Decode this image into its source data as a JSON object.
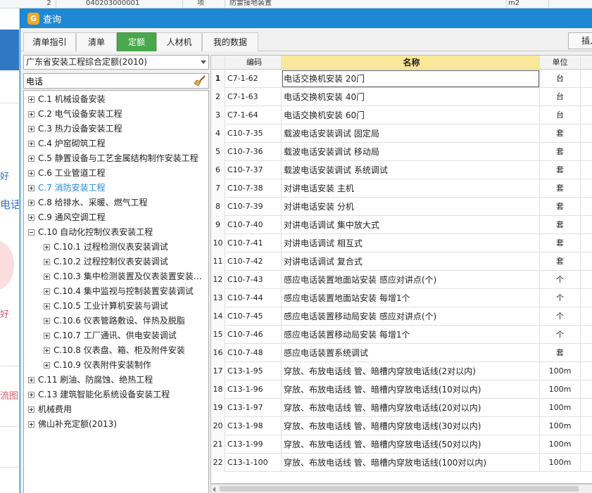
{
  "background": {
    "row_number": "2",
    "code": "040203000001",
    "col3": "项",
    "name": "防雷接地装置",
    "unit": "m2",
    "left_fragments": [
      "好",
      "电话",
      "好",
      "流图"
    ]
  },
  "window": {
    "title": "查询",
    "logo_glyph": "G"
  },
  "tabs": [
    {
      "label": "清单指引"
    },
    {
      "label": "清单"
    },
    {
      "label": "定额",
      "active": true
    },
    {
      "label": "人材机"
    },
    {
      "label": "我的数据"
    }
  ],
  "insert_button": "插入",
  "left": {
    "quota_library": "广东省安装工程综合定额(2010)",
    "search_value": "电话",
    "tree": [
      {
        "label": "C.1 机械设备安装",
        "expanded": false
      },
      {
        "label": "C.2 电气设备安装工程",
        "expanded": false
      },
      {
        "label": "C.3 热力设备安装工程",
        "expanded": false
      },
      {
        "label": "C.4 炉窑砌筑工程",
        "expanded": false
      },
      {
        "label": "C.5 静置设备与工艺金属结构制作安装工程",
        "expanded": false
      },
      {
        "label": "C.6 工业管道工程",
        "expanded": false
      },
      {
        "label": "C.7 消防安装工程",
        "expanded": false,
        "selected": true
      },
      {
        "label": "C.8 给排水、采暖、燃气工程",
        "expanded": false
      },
      {
        "label": "C.9 通风空调工程",
        "expanded": false
      },
      {
        "label": "C.10 自动化控制仪表安装工程",
        "expanded": true
      },
      {
        "label": "C.10.1 过程检测仪表安装调试",
        "level": 1
      },
      {
        "label": "C.10.2 过程控制仪表安装调试",
        "level": 1
      },
      {
        "label": "C.10.3 集中检测装置及仪表装置安装…",
        "level": 1
      },
      {
        "label": "C.10.4 集中监视与控制装置安装调试",
        "level": 1
      },
      {
        "label": "C.10.5 工业计算机安装与调试",
        "level": 1
      },
      {
        "label": "C.10.6 仪表管路敷设、伴热及脱脂",
        "level": 1
      },
      {
        "label": "C.10.7 工厂通讯、供电安装调试",
        "level": 1
      },
      {
        "label": "C.10.8 仪表盘、箱、柜及附件安装",
        "level": 1
      },
      {
        "label": "C.10.9 仪表附件安装制作",
        "level": 1
      },
      {
        "label": "C.11 刷油、防腐蚀、绝热工程",
        "expanded": false
      },
      {
        "label": "C.13 建筑智能化系统设备安装工程",
        "expanded": false
      },
      {
        "label": "机械费用",
        "expanded": false
      },
      {
        "label": "佛山补充定额(2013)",
        "expanded": false
      }
    ]
  },
  "grid": {
    "headers": {
      "code": "编码",
      "name": "名称",
      "unit": "单位"
    },
    "rows": [
      {
        "idx": "1",
        "code": "C7-1-62",
        "name": "电话交换机安装 20门",
        "unit": "台"
      },
      {
        "idx": "2",
        "code": "C7-1-63",
        "name": "电话交换机安装 40门",
        "unit": "台"
      },
      {
        "idx": "3",
        "code": "C7-1-64",
        "name": "电话交换机安装 60门",
        "unit": "台"
      },
      {
        "idx": "4",
        "code": "C10-7-35",
        "name": "载波电话安装调试 固定局",
        "unit": "套"
      },
      {
        "idx": "5",
        "code": "C10-7-36",
        "name": "载波电话安装调试 移动局",
        "unit": "套"
      },
      {
        "idx": "6",
        "code": "C10-7-37",
        "name": "载波电话安装调试 系统调试",
        "unit": "套"
      },
      {
        "idx": "7",
        "code": "C10-7-38",
        "name": "对讲电话安装 主机",
        "unit": "套"
      },
      {
        "idx": "8",
        "code": "C10-7-39",
        "name": "对讲电话安装 分机",
        "unit": "套"
      },
      {
        "idx": "9",
        "code": "C10-7-40",
        "name": "对讲电话调试 集中放大式",
        "unit": "套"
      },
      {
        "idx": "10",
        "code": "C10-7-41",
        "name": "对讲电话调试 相互式",
        "unit": "套"
      },
      {
        "idx": "11",
        "code": "C10-7-42",
        "name": "对讲电话调试 复合式",
        "unit": "套"
      },
      {
        "idx": "12",
        "code": "C10-7-43",
        "name": "感应电话装置地面站安装 感应对讲点(个)",
        "unit": "个"
      },
      {
        "idx": "13",
        "code": "C10-7-44",
        "name": "感应电话装置地面站安装 每增1个",
        "unit": "个"
      },
      {
        "idx": "14",
        "code": "C10-7-45",
        "name": "感应电话装置移动局安装 感应对讲点(个)",
        "unit": "个"
      },
      {
        "idx": "15",
        "code": "C10-7-46",
        "name": "感应电话装置移动局安装 每增1个",
        "unit": "个"
      },
      {
        "idx": "16",
        "code": "C10-7-48",
        "name": "感应电话装置系统调试",
        "unit": "套"
      },
      {
        "idx": "17",
        "code": "C13-1-95",
        "name": "穿放、布放电话线 管、暗槽内穿放电话线(2对以内)",
        "unit": "100m"
      },
      {
        "idx": "18",
        "code": "C13-1-96",
        "name": "穿放、布放电话线 管、暗槽内穿放电话线(10对以内)",
        "unit": "100m"
      },
      {
        "idx": "19",
        "code": "C13-1-97",
        "name": "穿放、布放电话线 管、暗槽内穿放电话线(20对以内)",
        "unit": "100m"
      },
      {
        "idx": "20",
        "code": "C13-1-98",
        "name": "穿放、布放电话线 管、暗槽内穿放电话线(30对以内)",
        "unit": "100m"
      },
      {
        "idx": "21",
        "code": "C13-1-99",
        "name": "穿放、布放电话线 管、暗槽内穿放电话线(50对以内)",
        "unit": "100m"
      },
      {
        "idx": "22",
        "code": "C13-1-100",
        "name": "穿放、布放电话线 管、暗槽内穿放电话线(100对以内)",
        "unit": "100m"
      }
    ]
  }
}
